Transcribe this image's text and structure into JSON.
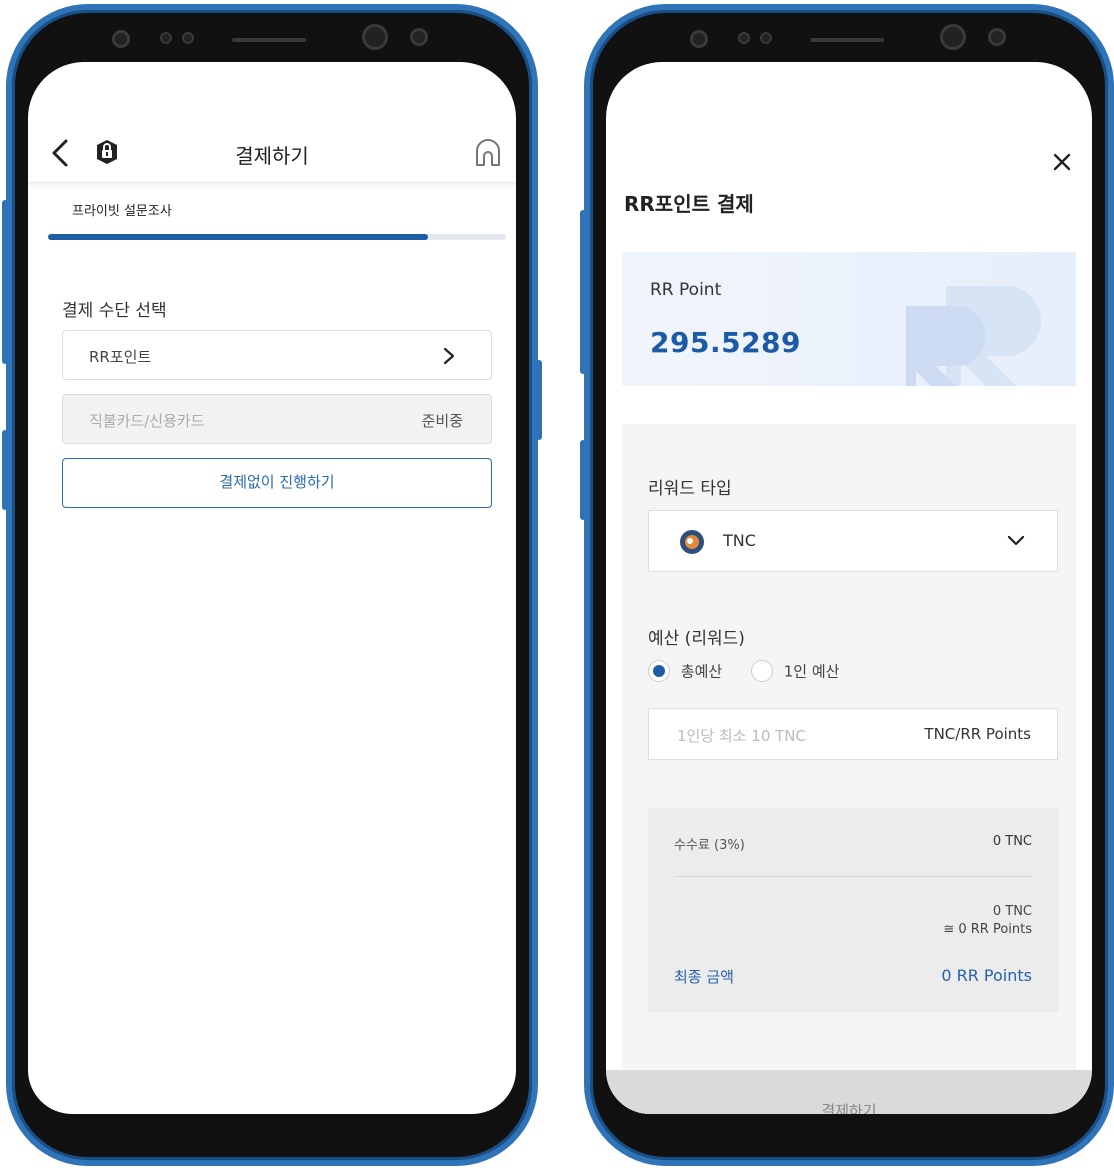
{
  "left": {
    "header_title": "결제하기",
    "subtitle": "프라이빗 설문조사",
    "progress": 0.83,
    "section_label": "결제 수단 선택",
    "options": [
      {
        "label": "RR포인트",
        "status": ""
      },
      {
        "label": "직불카드/신용카드",
        "status": "준비중"
      }
    ],
    "skip_button": "결제없이 진행하기"
  },
  "right": {
    "title": "RR포인트 결제",
    "point_label": "RR Point",
    "point_value": "295.5289",
    "reward_type_label": "리워드 타입",
    "reward_type_value": "TNC",
    "budget_label": "예산 (리워드)",
    "radio_total": "총예산",
    "radio_per_person": "1인 예산",
    "amount_placeholder": "1인당 최소 10 TNC",
    "amount_unit": "TNC/RR Points",
    "fee_label": "수수료 (3%)",
    "fee_value": "0 TNC",
    "sub_value_1": "0 TNC",
    "sub_value_2": "≅  0 RR Points",
    "final_label": "최종 금액",
    "final_value": "0 RR Points",
    "pay_button": "결제하기"
  },
  "colors": {
    "accent": "#1e5ea6",
    "frame": "#2f73b8"
  },
  "icons": [
    "back-icon",
    "lock-icon",
    "home-icon",
    "chevron-right-icon",
    "close-icon",
    "rr-logo",
    "coin-icon",
    "chevron-down-icon"
  ]
}
